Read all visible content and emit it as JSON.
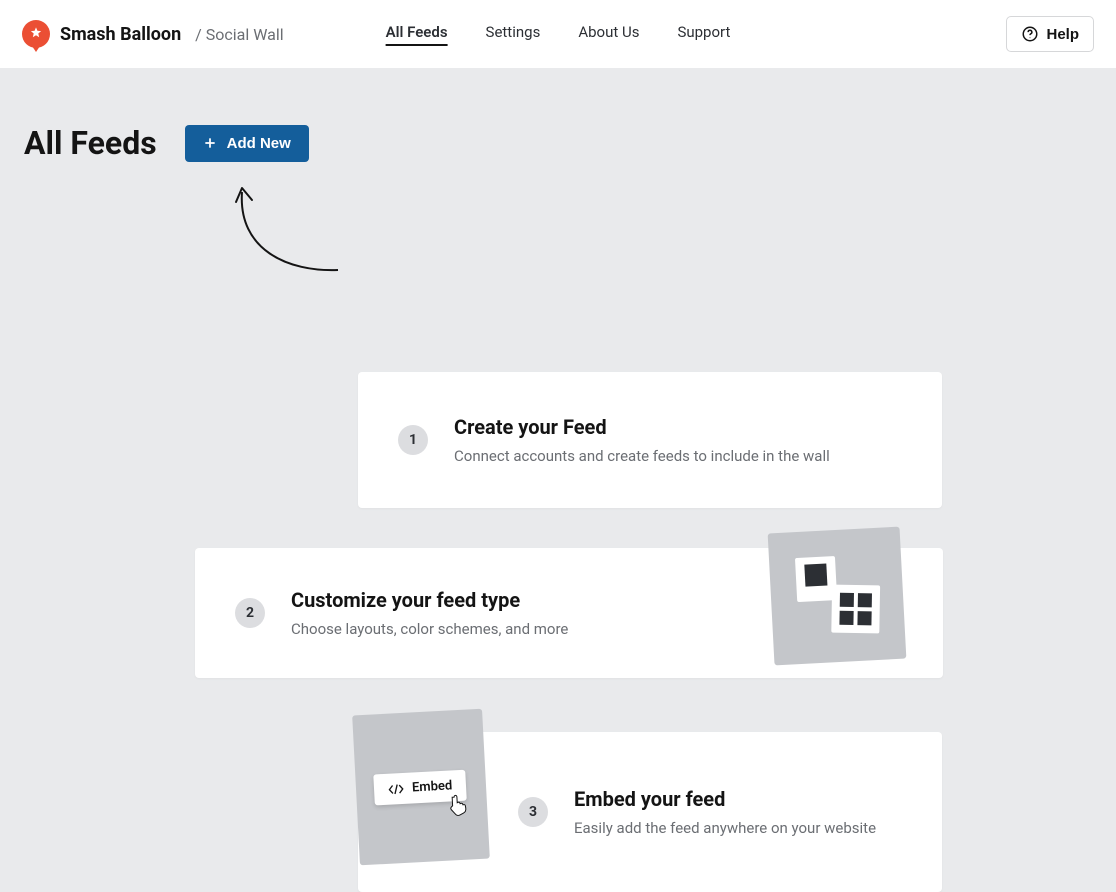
{
  "brand": {
    "name": "Smash Balloon",
    "sub": "/ Social Wall"
  },
  "nav": {
    "all_feeds": "All Feeds",
    "settings": "Settings",
    "about": "About Us",
    "support": "Support"
  },
  "help_label": "Help",
  "page_title": "All Feeds",
  "add_new_label": "Add New",
  "steps": {
    "s1": {
      "num": "1",
      "title": "Create your Feed",
      "desc": "Connect accounts and create feeds to include in the wall"
    },
    "s2": {
      "num": "2",
      "title": "Customize your feed type",
      "desc": "Choose layouts, color schemes, and more"
    },
    "s3": {
      "num": "3",
      "title": "Embed your feed",
      "desc": "Easily add the feed anywhere on your website"
    }
  },
  "embed_chip_label": "Embed"
}
